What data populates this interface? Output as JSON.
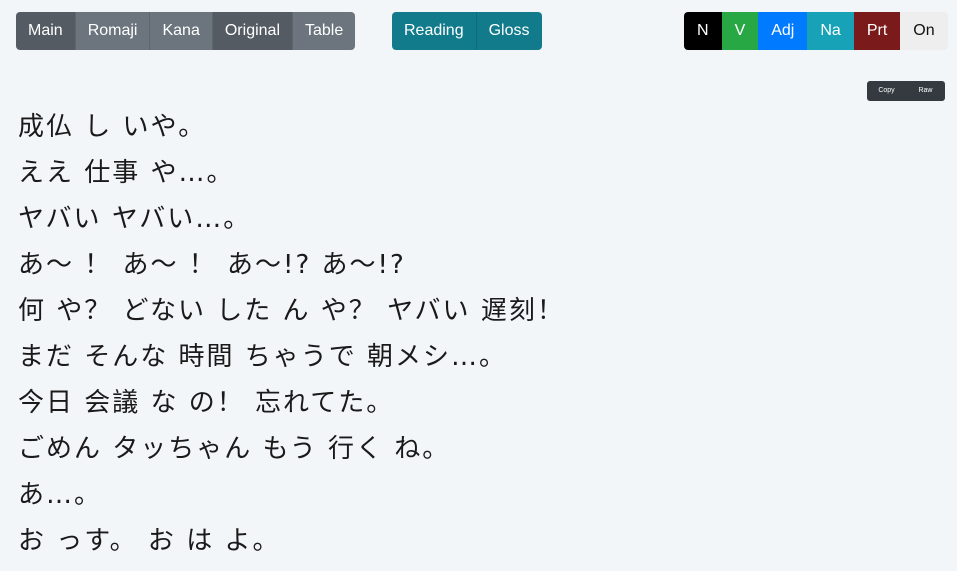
{
  "toolbar": {
    "view_modes": [
      {
        "label": "Main",
        "active": true
      },
      {
        "label": "Romaji",
        "active": false
      },
      {
        "label": "Kana",
        "active": false
      },
      {
        "label": "Original",
        "active": true
      },
      {
        "label": "Table",
        "active": false
      }
    ],
    "aux_modes": [
      {
        "label": "Reading"
      },
      {
        "label": "Gloss"
      }
    ],
    "pos_tags": [
      {
        "label": "N",
        "bg": "#000000",
        "fg": "#ffffff"
      },
      {
        "label": "V",
        "bg": "#28a745",
        "fg": "#ffffff"
      },
      {
        "label": "Adj",
        "bg": "#007bff",
        "fg": "#ffffff"
      },
      {
        "label": "Na",
        "bg": "#17a2b8",
        "fg": "#ffffff"
      },
      {
        "label": "Prt",
        "bg": "#7b1a1a",
        "fg": "#ffffff"
      },
      {
        "label": "On",
        "bg": "#eeeeee",
        "fg": "#111111"
      }
    ]
  },
  "copy_controls": {
    "copy_label": "Copy",
    "raw_label": "Raw"
  },
  "transcript": {
    "lines": [
      "成仏 し いや。",
      "ええ 仕事 や…。",
      "ヤバい ヤバい…。",
      "あ～ ！ あ～ ！ あ～!? あ～!?",
      "何 や？ どない した ん や？ ヤバい 遅刻！",
      "まだ そんな 時間 ちゃうで 朝メシ…。",
      "今日 会議 な の！ 忘れてた。",
      "ごめん タッちゃん もう 行く ね。",
      "あ…。",
      "お っす。 お は よ。"
    ]
  }
}
